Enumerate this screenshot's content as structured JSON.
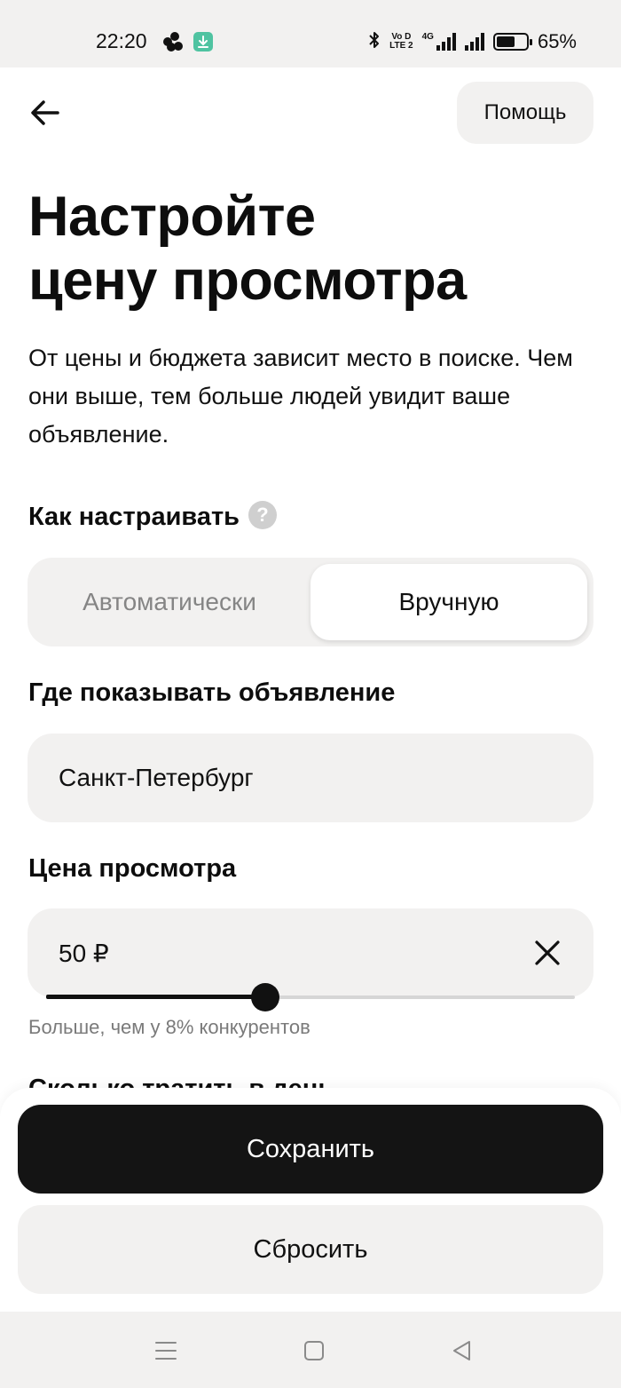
{
  "status_bar": {
    "time": "22:20",
    "battery_percent": "65%",
    "battery_level": 0.65,
    "network_label": "4G",
    "volte_label_top": "Vo D",
    "volte_label_bottom": "LTE 2",
    "icons": [
      "app-dots-icon",
      "download-icon",
      "bluetooth-icon",
      "volte-icon",
      "signal-4g-icon",
      "signal-icon",
      "battery-icon"
    ]
  },
  "header": {
    "back_icon": "arrow-left-icon",
    "help_label": "Помощь"
  },
  "page": {
    "title_line1": "Настройте",
    "title_line2": "цену просмотра",
    "subtitle": "От цены и бюджета зависит место в поиске. Чем они выше, тем больше людей увидит ваше объявление."
  },
  "setup_mode": {
    "label": "Как настраивать",
    "help_icon_glyph": "?",
    "options": [
      "Автоматически",
      "Вручную"
    ],
    "selected": "Вручную"
  },
  "location": {
    "label": "Где показывать объявление",
    "value": "Санкт-Петербург"
  },
  "price": {
    "label": "Цена просмотра",
    "value": "50 ₽",
    "slider_fraction": 0.415,
    "hint": "Больше, чем у 8% конкурентов"
  },
  "daily_budget": {
    "label": "Сколько тратить в день"
  },
  "actions": {
    "save_label": "Сохранить",
    "reset_label": "Сбросить"
  },
  "system_nav": {
    "icons": [
      "menu-icon",
      "home-square-icon",
      "back-triangle-icon"
    ]
  },
  "colors": {
    "surface": "#f2f1f0",
    "primary_button": "#141414",
    "muted_text": "#7a7a7a",
    "help_badge": "#cfcfcf",
    "download_badge": "#4fc3a1"
  }
}
